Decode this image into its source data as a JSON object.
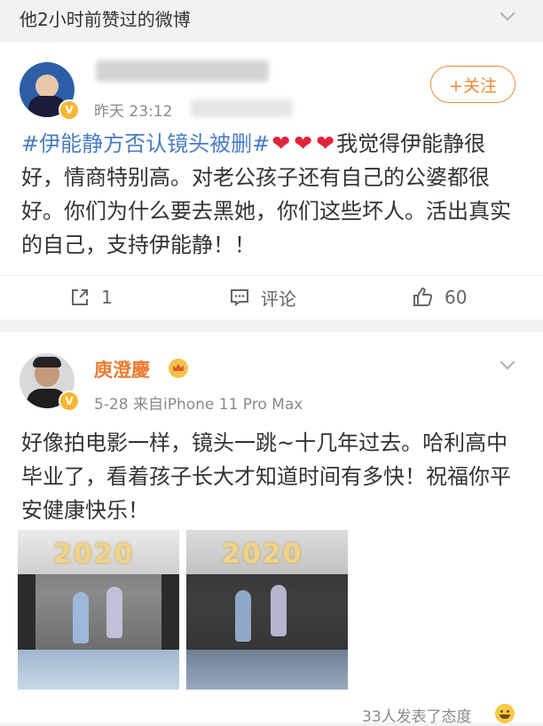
{
  "section": {
    "title": "他2小时前赞过的微博"
  },
  "post1": {
    "time": "昨天 23:12",
    "follow_label": "+关注",
    "topic": "#伊能静方否认镜头被删#",
    "text_after_hearts": "我觉得伊能静很好，情商特别高。对老公孩子还有自己的公婆都很好。你们为什么要去黑她，你们这些坏人。活出真实的自己，支持伊能静！！",
    "actions": {
      "repost": "1",
      "comment": "评论",
      "like": "60"
    }
  },
  "post2": {
    "name": "庾澄慶",
    "meta": "5-28  来自iPhone 11 Pro Max",
    "text": "好像拍电影一样，镜头一跳~十几年过去。哈利高中毕业了，看着孩子长大才知道时间有多快！祝福你平安健康快乐！",
    "photo_banner": "2020",
    "reactions": "33人发表了态度"
  }
}
